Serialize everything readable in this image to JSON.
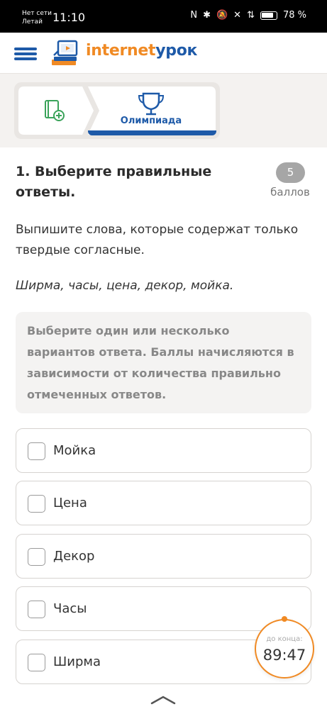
{
  "status_bar": {
    "carrier_line1": "Нет сети",
    "carrier_line2": "Летай",
    "time": "11:10",
    "battery": "78 %"
  },
  "header": {
    "logo_part1": "internet",
    "logo_part2": "урок",
    "brand_colors": {
      "orange": "#f08a24",
      "blue": "#1e5aa8"
    }
  },
  "tabs": [
    {
      "icon": "book-add-icon",
      "label": ""
    },
    {
      "icon": "trophy-icon",
      "label": "Олимпиада",
      "active": true
    }
  ],
  "question": {
    "title": "1. Выберите правильные ответы.",
    "score": "5",
    "score_unit": "баллов",
    "text": "Выпишите слова, которые содержат только твердые согласные.",
    "words": "Ширма, часы, цена, декор, мойка.",
    "hint": "Выберите один или несколько вариантов ответа. Баллы начисляются в зависимости от количества правильно отмеченных ответов."
  },
  "options": [
    {
      "label": "Мойка",
      "checked": false
    },
    {
      "label": "Цена",
      "checked": false
    },
    {
      "label": "Декор",
      "checked": false
    },
    {
      "label": "Часы",
      "checked": false
    },
    {
      "label": "Ширма",
      "checked": false
    }
  ],
  "timer": {
    "label": "до конца:",
    "value": "89:47"
  }
}
